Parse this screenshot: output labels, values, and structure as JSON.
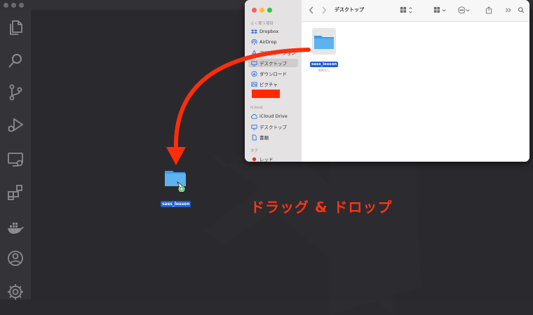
{
  "finder": {
    "title": "デスクトップ",
    "sidebar": {
      "favorites_header": "よく使う項目",
      "favorites": [
        {
          "label": "Dropbox",
          "icon": "dropbox-icon"
        },
        {
          "label": "AirDrop",
          "icon": "airdrop-icon"
        },
        {
          "label": "アプリケーション",
          "icon": "applications-icon"
        },
        {
          "label": "デスクトップ",
          "icon": "desktop-icon",
          "selected": true
        },
        {
          "label": "ダウンロード",
          "icon": "download-icon"
        },
        {
          "label": "ピクチャ",
          "icon": "pictures-icon"
        }
      ],
      "icloud_header": "iCloud",
      "icloud": [
        {
          "label": "iCloud Drive",
          "icon": "cloud-icon"
        },
        {
          "label": "デスクトップ",
          "icon": "desktop-icon"
        },
        {
          "label": "書類",
          "icon": "document-icon"
        }
      ],
      "tags_header": "タグ",
      "tags": [
        {
          "label": "レッド",
          "color": "#e0312b"
        }
      ]
    },
    "content": {
      "folder_name": "sass_lesson",
      "folder_sub": "項目なし"
    }
  },
  "drag": {
    "folder_name": "sass_lesson"
  },
  "caption": "ドラッグ & ドロップ",
  "colors": {
    "arrow": "#ff2d0a",
    "selection": "#1d5fd6",
    "folder": "#5cb3f0"
  }
}
